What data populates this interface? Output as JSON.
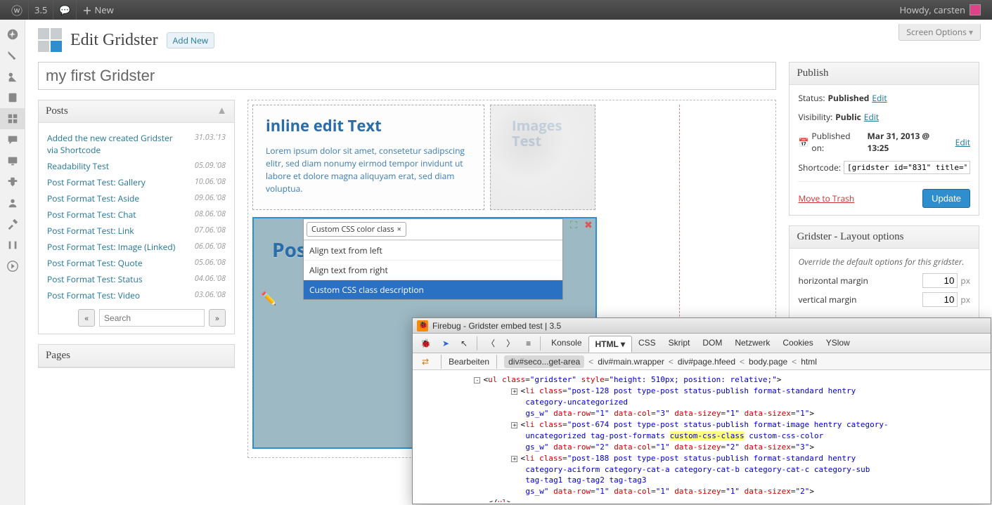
{
  "adminbar": {
    "version": "3.5",
    "new_label": "New",
    "howdy": "Howdy, carsten"
  },
  "screen_options": "Screen Options",
  "heading": {
    "title": "Edit Gridster",
    "add_new": "Add New"
  },
  "title_value": "my first Gridster",
  "posts_box": {
    "title": "Posts",
    "items": [
      {
        "title": "Added the new created Gridster via Shortcode",
        "date": "31.03.'13"
      },
      {
        "title": "Readability Test",
        "date": "05.09.'08"
      },
      {
        "title": "Post Format Test: Gallery",
        "date": "10.06.'08"
      },
      {
        "title": "Post Format Test: Aside",
        "date": "09.06.'08"
      },
      {
        "title": "Post Format Test: Chat",
        "date": "08.06.'08"
      },
      {
        "title": "Post Format Test: Link",
        "date": "07.06.'08"
      },
      {
        "title": "Post Format Test: Image (Linked)",
        "date": "06.06.'08"
      },
      {
        "title": "Post Format Test: Quote",
        "date": "05.06.'08"
      },
      {
        "title": "Post Format Test: Status",
        "date": "04.06.'08"
      },
      {
        "title": "Post Format Test: Video",
        "date": "03.06.'08"
      }
    ],
    "search_placeholder": "Search",
    "prev": "«",
    "next": "»"
  },
  "pages_box": {
    "title": "Pages"
  },
  "canvas": {
    "block1": {
      "title": "inline edit Text",
      "body": "Lorem ipsum dolor sit amet, consetetur sadipscing elitr, sed diam nonumy eirmod tempor invidunt ut labore et dolore magna aliquyam erat, sed diam voluptua."
    },
    "block2": {
      "title": "Images Test"
    },
    "block3": {
      "title": "Pos",
      "selected_tag": "Custom CSS color class",
      "options": [
        "Align text from left",
        "Align text from right",
        "Custom CSS class description"
      ],
      "hl_index": 2
    }
  },
  "publish": {
    "title": "Publish",
    "status_lbl": "Status:",
    "status_val": "Published",
    "edit": "Edit",
    "vis_lbl": "Visibility:",
    "vis_val": "Public",
    "pub_lbl": "Published on:",
    "pub_val": "Mar 31, 2013 @ 13:25",
    "short_lbl": "Shortcode:",
    "short_val": "[gridster id=\"831\" title=\"m",
    "trash": "Move to Trash",
    "update": "Update"
  },
  "layout": {
    "title": "Gridster - Layout options",
    "desc": "Override the default options for this gridster.",
    "rows": [
      {
        "label": "horizontal margin",
        "value": "10",
        "unit": "px"
      },
      {
        "label": "vertical margin",
        "value": "10",
        "unit": "px"
      }
    ]
  },
  "firebug": {
    "title": "Firebug - Gridster embed test | 3.5",
    "tabs": [
      "Konsole",
      "HTML",
      "CSS",
      "Skript",
      "DOM",
      "Netzwerk",
      "Cookies",
      "YSlow"
    ],
    "active_tab": 1,
    "edit_label": "Bearbeiten",
    "crumbs": [
      "div#seco...get-area",
      "div#main.wrapper",
      "div#page.hfeed",
      "body.page",
      "html"
    ],
    "lines": [
      {
        "ind": 3,
        "t": "open",
        "toggle": "-",
        "html": "<span class='tok-plain'>&lt;</span><span class='tok-tag'>ul</span> <span class='tok-attr'>class</span>=<span class='tok-val'>\"gridster\"</span> <span class='tok-attr'>style</span>=<span class='tok-val'>\"height: 510px; position: relative;\"</span><span class='tok-plain'>&gt;</span>"
      },
      {
        "ind": 5,
        "t": "open",
        "toggle": "+",
        "html": "<span class='tok-plain'>&lt;</span><span class='tok-tag'>li</span> <span class='tok-attr'>class</span>=<span class='tok-val'>\"post-128 post type-post status-publish format-standard hentry</span>"
      },
      {
        "ind": 5,
        "html": "<span class='tok-val'>category-uncategorized</span>"
      },
      {
        "ind": 5,
        "html": "<span class='tok-val'>gs_w\"</span> <span class='tok-attr'>data-row</span>=<span class='tok-val'>\"1\"</span> <span class='tok-attr'>data-col</span>=<span class='tok-val'>\"3\"</span> <span class='tok-attr'>data-sizey</span>=<span class='tok-val'>\"1\"</span> <span class='tok-attr'>data-sizex</span>=<span class='tok-val'>\"1\"</span><span class='tok-plain'>&gt;</span>"
      },
      {
        "ind": 5,
        "t": "open",
        "toggle": "+",
        "html": "<span class='tok-plain'>&lt;</span><span class='tok-tag'>li</span> <span class='tok-attr'>class</span>=<span class='tok-val'>\"post-674 post type-post status-publish format-image hentry category-</span>"
      },
      {
        "ind": 5,
        "html": "<span class='tok-val'>uncategorized tag-post-formats </span><span class='tok-val tok-hl'>custom-css-class</span><span class='tok-val'> custom-css-color</span>"
      },
      {
        "ind": 5,
        "html": "<span class='tok-val'>gs_w\"</span> <span class='tok-attr'>data-row</span>=<span class='tok-val'>\"2\"</span> <span class='tok-attr'>data-col</span>=<span class='tok-val'>\"1\"</span> <span class='tok-attr'>data-sizey</span>=<span class='tok-val'>\"2\"</span> <span class='tok-attr'>data-sizex</span>=<span class='tok-val'>\"3\"</span><span class='tok-plain'>&gt;</span>"
      },
      {
        "ind": 5,
        "t": "open",
        "toggle": "+",
        "html": "<span class='tok-plain'>&lt;</span><span class='tok-tag'>li</span> <span class='tok-attr'>class</span>=<span class='tok-val'>\"post-188 post type-post status-publish format-standard hentry</span>"
      },
      {
        "ind": 5,
        "html": "<span class='tok-val'>category-aciform category-cat-a category-cat-b category-cat-c category-sub</span>"
      },
      {
        "ind": 5,
        "html": "<span class='tok-val'>tag-tag1 tag-tag2 tag-tag3</span>"
      },
      {
        "ind": 5,
        "html": "<span class='tok-val'>gs_w\"</span> <span class='tok-attr'>data-row</span>=<span class='tok-val'>\"1\"</span> <span class='tok-attr'>data-col</span>=<span class='tok-val'>\"1\"</span> <span class='tok-attr'>data-sizey</span>=<span class='tok-val'>\"1\"</span> <span class='tok-attr'>data-sizex</span>=<span class='tok-val'>\"2\"</span><span class='tok-plain'>&gt;</span>"
      },
      {
        "ind": 3,
        "html": "<span class='tok-plain'>&lt;/</span><span class='tok-tag'>ul</span><span class='tok-plain'>&gt;</span>"
      }
    ]
  }
}
